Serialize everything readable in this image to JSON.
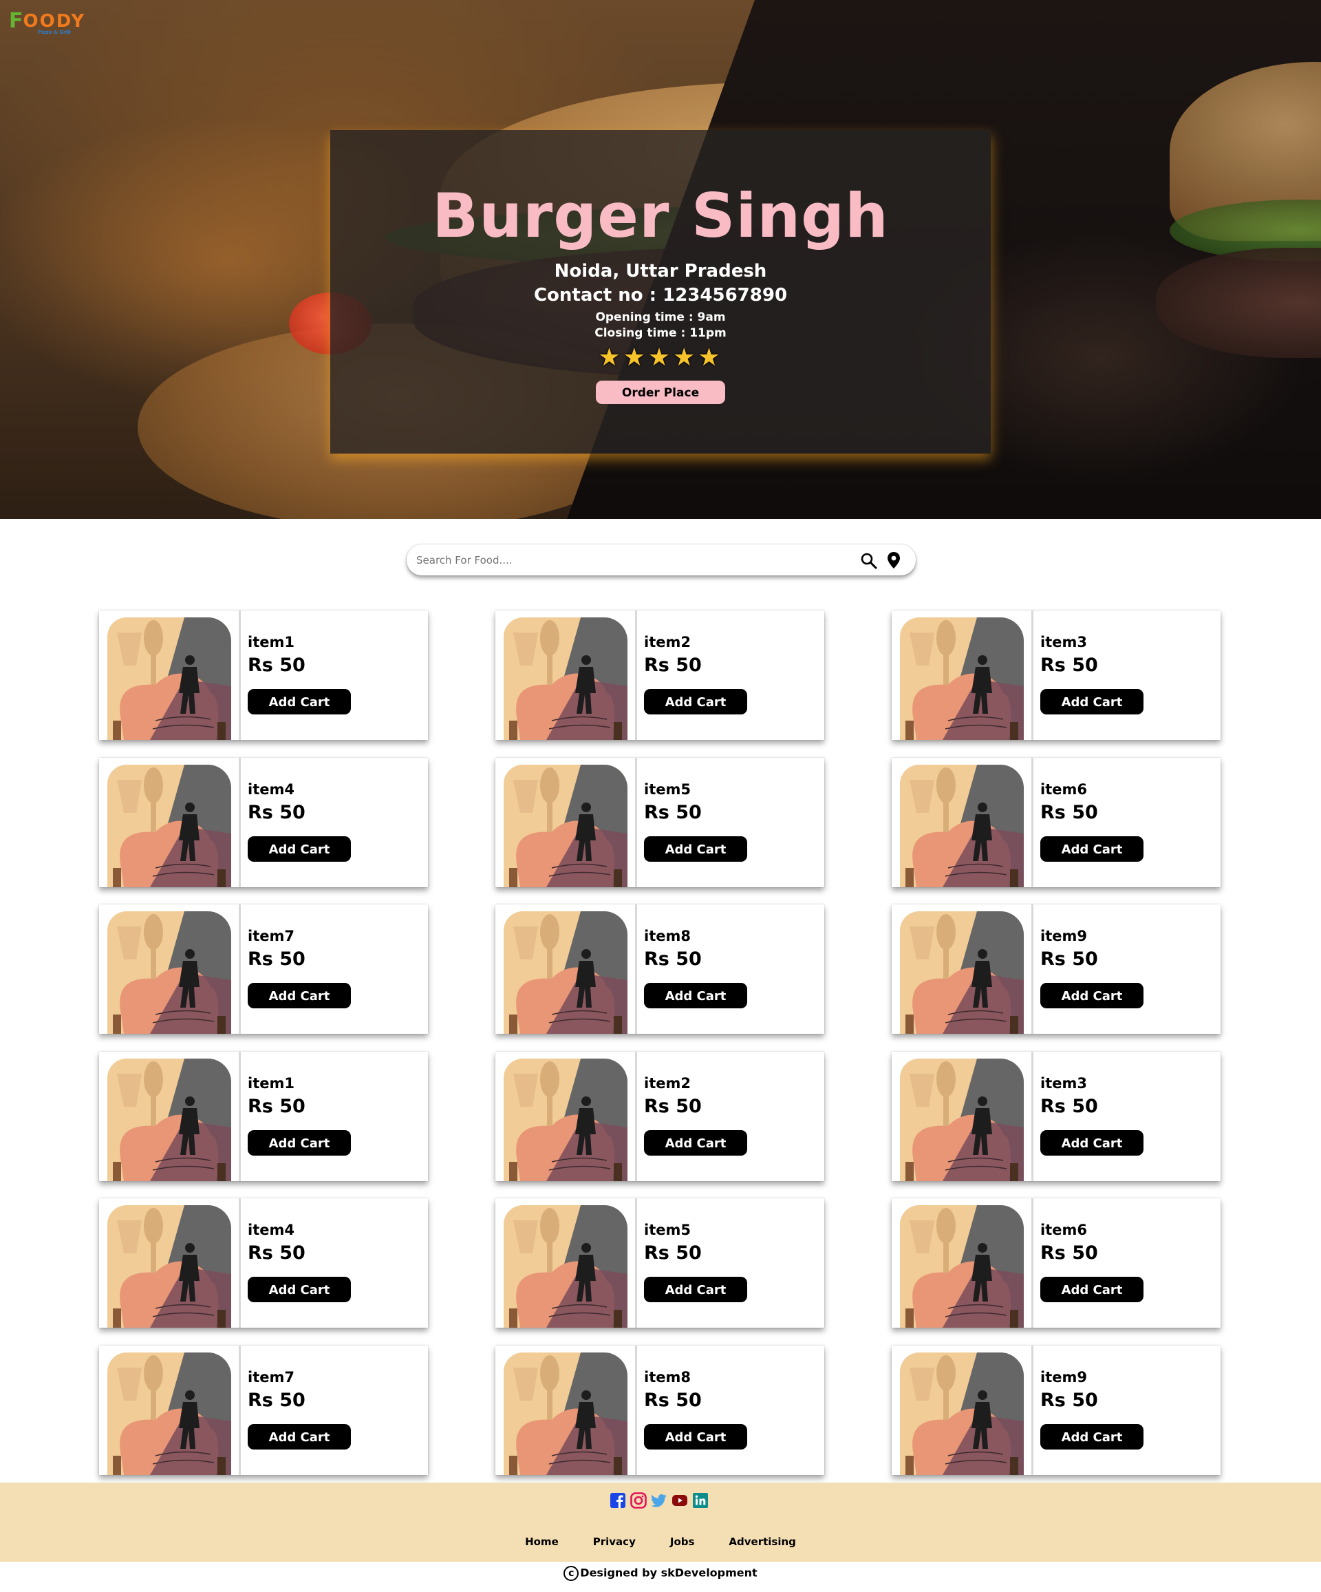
{
  "brand": {
    "logo_leaf": "F",
    "logo_word": "OODY",
    "logo_sub": "Pizza & Grill"
  },
  "restaurant": {
    "name": "Burger Singh",
    "location": "Noida, Uttar Pradesh",
    "contact": "Contact no : 1234567890",
    "opening": "Opening time : 9am",
    "closing": "Closing time : 11pm",
    "rating_stars": "★★★★★",
    "rating": 5,
    "order_label": "Order Place"
  },
  "search": {
    "placeholder": "Search For Food....",
    "value": ""
  },
  "menu": {
    "items": [
      {
        "name": "item1",
        "price": "Rs 50",
        "button": "Add Cart"
      },
      {
        "name": "item2",
        "price": "Rs 50",
        "button": "Add Cart"
      },
      {
        "name": "item3",
        "price": "Rs 50",
        "button": "Add Cart"
      },
      {
        "name": "item4",
        "price": "Rs 50",
        "button": "Add Cart"
      },
      {
        "name": "item5",
        "price": "Rs 50",
        "button": "Add Cart"
      },
      {
        "name": "item6",
        "price": "Rs 50",
        "button": "Add Cart"
      },
      {
        "name": "item7",
        "price": "Rs 50",
        "button": "Add Cart"
      },
      {
        "name": "item8",
        "price": "Rs 50",
        "button": "Add Cart"
      },
      {
        "name": "item9",
        "price": "Rs 50",
        "button": "Add Cart"
      },
      {
        "name": "item1",
        "price": "Rs 50",
        "button": "Add Cart"
      },
      {
        "name": "item2",
        "price": "Rs 50",
        "button": "Add Cart"
      },
      {
        "name": "item3",
        "price": "Rs 50",
        "button": "Add Cart"
      },
      {
        "name": "item4",
        "price": "Rs 50",
        "button": "Add Cart"
      },
      {
        "name": "item5",
        "price": "Rs 50",
        "button": "Add Cart"
      },
      {
        "name": "item6",
        "price": "Rs 50",
        "button": "Add Cart"
      },
      {
        "name": "item7",
        "price": "Rs 50",
        "button": "Add Cart"
      },
      {
        "name": "item8",
        "price": "Rs 50",
        "button": "Add Cart"
      },
      {
        "name": "item9",
        "price": "Rs 50",
        "button": "Add Cart"
      }
    ]
  },
  "footer": {
    "social": [
      "facebook-icon",
      "instagram-icon",
      "twitter-icon",
      "youtube-icon",
      "linkedin-icon"
    ],
    "links": [
      "Home",
      "Privacy",
      "Jobs",
      "Advertising"
    ],
    "copyright_symbol": "c",
    "credits": "Designed by skDevelopment"
  },
  "colors": {
    "accent_pink": "#f9bcc5",
    "footer_bg": "#f4deb3",
    "button_black": "#000000",
    "star_gold": "#f7c32a"
  }
}
